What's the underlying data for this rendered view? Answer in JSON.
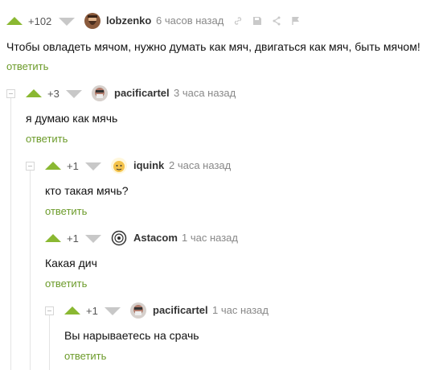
{
  "colors": {
    "accent_green": "#8ab832",
    "reply_green": "#6c9b2a",
    "downvote_gray": "#c8c8c8"
  },
  "reply_label": "ответить",
  "comments": [
    {
      "rating": "+102",
      "author": "lobzenko",
      "time": "6 часов назад",
      "text": "Чтобы овладеть мячом, нужно думать как мяч, двигаться как мяч, быть мячом!",
      "avatar": "bearded-man-avatar"
    },
    {
      "rating": "+3",
      "author": "pacificartel",
      "time": "3 часа назад",
      "text": "я думаю как мячь",
      "avatar": "masked-face-avatar"
    },
    {
      "rating": "+1",
      "author": "iquink",
      "time": "2 часа назад",
      "text": "кто такая мячь?",
      "avatar": "cartoon-face-avatar"
    },
    {
      "rating": "+1",
      "author": "Astacom",
      "time": "1 час назад",
      "text": "Какая дич",
      "avatar": "emblem-avatar"
    },
    {
      "rating": "+1",
      "author": "pacificartel",
      "time": "1 час назад",
      "text": "Вы нарываетесь на срачь",
      "avatar": "masked-face-avatar"
    }
  ]
}
